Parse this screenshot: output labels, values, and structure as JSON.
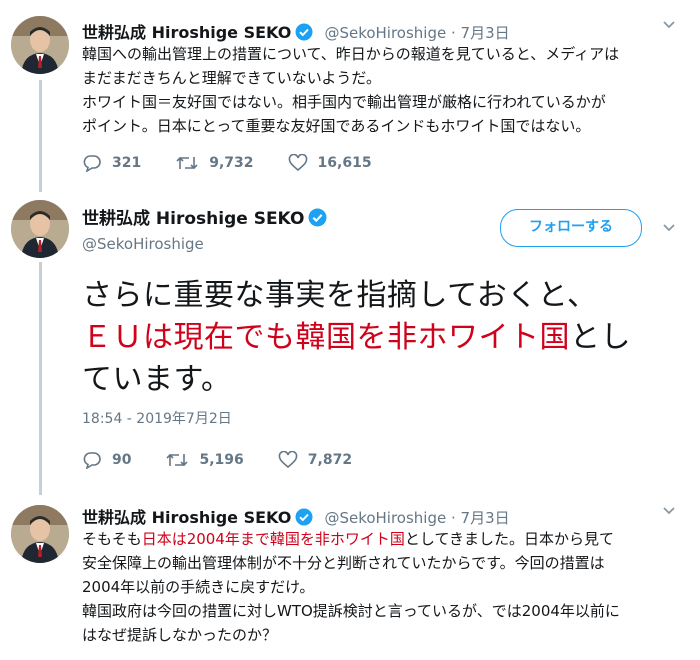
{
  "tweet1": {
    "name": "世耕弘成 Hiroshige SEKO",
    "handle": "@SekoHiroshige",
    "sep_date": " · 7月3日",
    "lines": [
      "韓国への輸出管理上の措置について、昨日からの報道を見ていると、メディアは",
      "まだまだきちんと理解できていないようだ。",
      "ホワイト国＝友好国ではない。相手国内で輸出管理が厳格に行われているかが",
      "ポイント。日本にとって重要な友好国であるインドもホワイト国ではない。"
    ],
    "replies": "321",
    "retweets": "9,732",
    "likes": "16,615"
  },
  "tweet2": {
    "name": "世耕弘成 Hiroshige SEKO",
    "handle": "@SekoHiroshige",
    "follow_label": "フォローする",
    "line1": "さらに重要な事実を指摘しておくと、",
    "line2_red": "ＥＵは現在でも韓国を非ホワイト国",
    "line2_black": "とし",
    "line3": "ています。",
    "timestamp": "18:54 - 2019年7月2日",
    "replies": "90",
    "retweets": "5,196",
    "likes": "7,872"
  },
  "tweet3": {
    "name": "世耕弘成 Hiroshige SEKO",
    "handle": "@SekoHiroshige",
    "sep_date": " · 7月3日",
    "l1_pre": "そもそも",
    "l1_red1": "日本は2004年まで",
    "l1_red2": "韓国を非ホワイト国",
    "l1_post": "としてきました。日本から見て",
    "lines": [
      "安全保障上の輸出管理体制が不十分と判断されていたからです。今回の措置は",
      "2004年以前の手続きに戻すだけ。",
      "韓国政府は今回の措置に対しWTO提訴検討と言っているが、では2004年以前に",
      "はなぜ提訴しなかったのか？"
    ]
  },
  "colors": {
    "accent": "#1da1f2",
    "highlight_red": "#d0021b",
    "secondary": "#657786"
  },
  "icons": [
    "verified-icon",
    "chevron-down-icon",
    "reply-icon",
    "retweet-icon",
    "like-icon"
  ]
}
